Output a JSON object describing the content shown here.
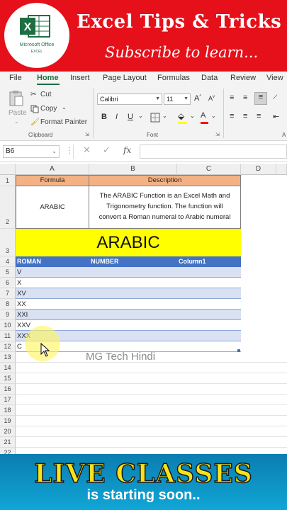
{
  "banner": {
    "logo_line1": "Microsoft Office",
    "logo_line2": "EXCEL",
    "title": "Excel Tips & Tricks",
    "subtitle": "Subscribe to learn...",
    "bg_color": "#e5101a"
  },
  "ribbon": {
    "tabs": [
      "File",
      "Home",
      "Insert",
      "Page Layout",
      "Formulas",
      "Data",
      "Review",
      "View"
    ],
    "active_tab": "Home",
    "clipboard": {
      "paste": "Paste",
      "cut": "Cut",
      "copy": "Copy",
      "format_painter": "Format Painter",
      "group_label": "Clipboard"
    },
    "font": {
      "font_name": "Calibri",
      "font_size": "11",
      "bold": "B",
      "italic": "I",
      "underline": "U",
      "font_color_glyph": "A",
      "group_label": "Font"
    },
    "alignment_group_initial": "A"
  },
  "formula_bar": {
    "name_box": "B6",
    "fx": "fx",
    "value": ""
  },
  "sheet": {
    "columns": [
      "A",
      "B",
      "C",
      "D"
    ],
    "rows": [
      "1",
      "2",
      "3",
      "4",
      "5",
      "6",
      "7",
      "8",
      "9",
      "10",
      "11",
      "12",
      "13",
      "14",
      "15",
      "16",
      "17",
      "18",
      "19",
      "20",
      "21",
      "22"
    ],
    "header_row": {
      "formula": "Formula",
      "description": "Description"
    },
    "row2": {
      "formula": "ARABIC",
      "description": [
        "The ARABIC Function is an Excel Math and",
        "Trigonometry function. The function will",
        "convert a Roman numeral to Arabic numeral"
      ]
    },
    "banner_title": "ARABIC",
    "table_headers": [
      "ROMAN",
      "NUMBER",
      "Column1"
    ],
    "roman_values": [
      "V",
      "X",
      "XV",
      "XX",
      "XXI",
      "XXV",
      "XXX",
      "C"
    ],
    "watermark": "MG Tech Hindi",
    "colors": {
      "header_fill": "#f4b183",
      "title_fill": "#ffff00",
      "table_header_fill": "#4472c4",
      "band_fill": "#d9e1f2"
    }
  },
  "bottom_banner": {
    "title": "LIVE CLASSES",
    "subtitle": "is starting soon.."
  }
}
